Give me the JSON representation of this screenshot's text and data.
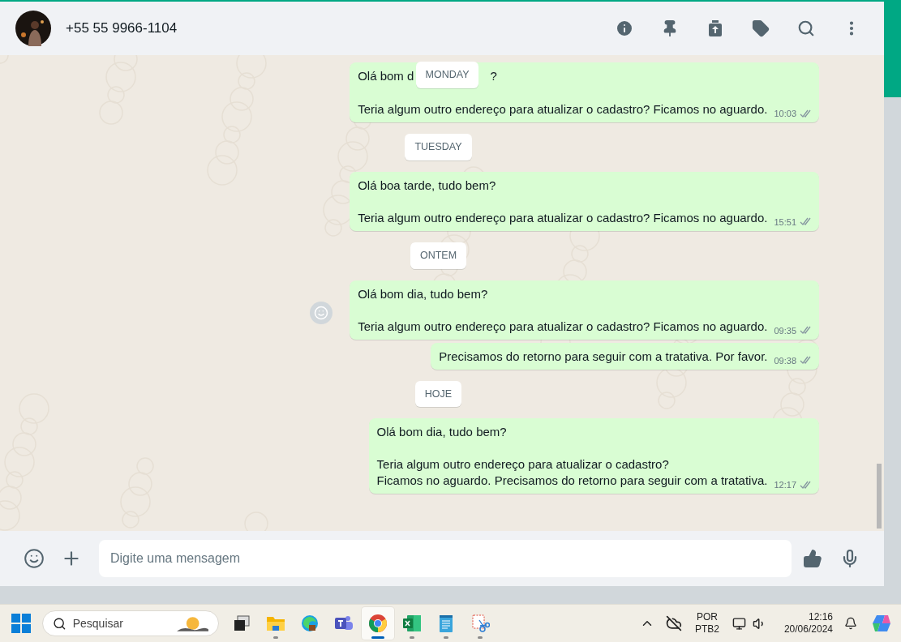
{
  "header": {
    "contact": "+55 55 9966-1104"
  },
  "sticky_date": "MONDAY",
  "chat": [
    {
      "kind": "message",
      "first_line_parts": [
        "Olá bom d",
        "?"
      ],
      "paragraphs": [
        [
          "Teria algum outro endereço para atualizar o cadastro? Ficamos no aguardo."
        ]
      ],
      "time": "10:03",
      "reaction_button": false
    },
    {
      "kind": "date",
      "label": "TUESDAY"
    },
    {
      "kind": "message",
      "paragraphs": [
        [
          "Olá boa tarde, tudo bem?"
        ],
        [
          "Teria algum outro endereço para atualizar o cadastro? Ficamos no aguardo."
        ]
      ],
      "time": "15:51",
      "reaction_button": false
    },
    {
      "kind": "date",
      "label": "ONTEM"
    },
    {
      "kind": "message",
      "paragraphs": [
        [
          "Olá bom dia, tudo bem?"
        ],
        [
          "Teria algum outro endereço para atualizar o cadastro? Ficamos no aguardo."
        ]
      ],
      "time": "09:35",
      "reaction_button": true
    },
    {
      "kind": "message",
      "paragraphs": [
        [
          "Precisamos do retorno para seguir com a tratativa. Por favor."
        ]
      ],
      "time": "09:38",
      "reaction_button": false
    },
    {
      "kind": "date",
      "label": "HOJE"
    },
    {
      "kind": "message",
      "paragraphs": [
        [
          "Olá bom dia, tudo bem?"
        ],
        [
          "Teria algum outro endereço para atualizar o cadastro?",
          "Ficamos no aguardo. Precisamos do retorno para seguir com a tratativa."
        ]
      ],
      "time": "12:17",
      "reaction_button": false
    }
  ],
  "composer": {
    "placeholder": "Digite uma mensagem"
  },
  "taskbar": {
    "search": {
      "placeholder": "Pesquisar"
    },
    "apps": [
      {
        "kind": "taskview",
        "running": false,
        "selected": false
      },
      {
        "kind": "folder",
        "running": true,
        "selected": false
      },
      {
        "kind": "edge",
        "running": false,
        "selected": false
      },
      {
        "kind": "teams",
        "running": false,
        "selected": false
      },
      {
        "kind": "chrome",
        "running": true,
        "selected": true
      },
      {
        "kind": "excel",
        "running": true,
        "selected": false
      },
      {
        "kind": "notepad",
        "running": true,
        "selected": false
      },
      {
        "kind": "snip",
        "running": true,
        "selected": false
      }
    ],
    "language": [
      "POR",
      "PTB2"
    ],
    "time": "12:16",
    "date": "20/06/2024"
  }
}
